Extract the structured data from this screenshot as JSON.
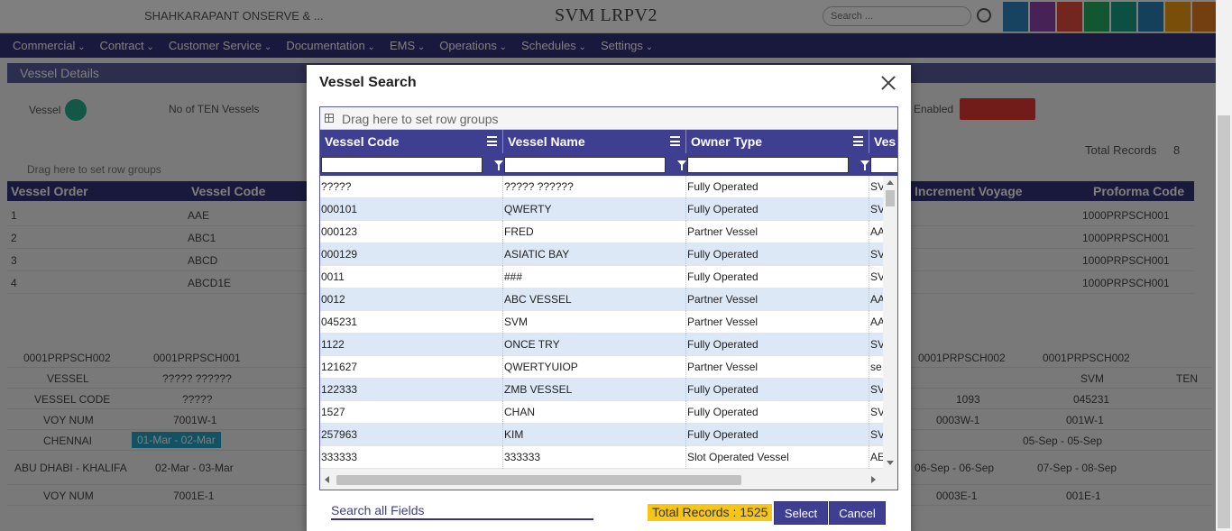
{
  "background": {
    "company": "SHAHKARAPANT ONSERVE & ...",
    "app_title": "SVM LRPV2",
    "search_placeholder": "Search ...",
    "nav": [
      "Commercial",
      "Contract",
      "Customer Service",
      "Documentation",
      "EMS",
      "Operations",
      "Schedules",
      "Settings"
    ],
    "section_title": "Vessel Details",
    "vessel_label": "Vessel",
    "ten_label": "No of TEN Vessels",
    "enabled_label": "Enabled",
    "total_records_label": "Total Records",
    "total_records_value": "8",
    "row_group_hint": "Drag here to set row groups",
    "grid_headers": [
      "Vessel Order",
      "Vessel Code",
      "Increment Voyage",
      "Proforma Code"
    ],
    "rows": [
      {
        "order": "1",
        "code": "AAE",
        "proforma": "1000PRPSCH001"
      },
      {
        "order": "2",
        "code": "ABC1",
        "proforma": "1000PRPSCH001"
      },
      {
        "order": "3",
        "code": "ABCD",
        "proforma": "1000PRPSCH001"
      },
      {
        "order": "4",
        "code": "ABCD1E",
        "proforma": "1000PRPSCH001"
      }
    ],
    "schedule": {
      "r1": [
        "0001PRPSCH002",
        "0001PRPSCH001",
        "0001PRPSCH002",
        "0001PRPSCH002"
      ],
      "r2": [
        "VESSEL",
        "????? ??????",
        "SVM",
        "TEN"
      ],
      "r3": [
        "VESSEL CODE",
        "?????",
        "1093",
        "045231"
      ],
      "r4": [
        "VOY NUM",
        "7001W-1",
        "0003W-1",
        "001W-1"
      ],
      "r5": [
        "CHENNAI",
        "01-Mar - 02-Mar",
        "05-Sep - 05-Sep"
      ],
      "r6": [
        "ABU DHABI - KHALIFA",
        "02-Mar - 03-Mar",
        "06-Sep - 06-Sep",
        "07-Sep - 08-Sep"
      ],
      "r7": [
        "VOY NUM",
        "7001E-1",
        "0003E-1",
        "001E-1"
      ]
    }
  },
  "modal": {
    "title": "Vessel Search",
    "group_hint": "Drag here to set row groups",
    "columns": [
      "Vessel Code",
      "Vessel Name",
      "Owner Type",
      "Ves"
    ],
    "rows": [
      [
        "?????",
        "????? ??????",
        "Fully Operated",
        "SV"
      ],
      [
        "000101",
        "QWERTY",
        "Fully Operated",
        "SV"
      ],
      [
        "000123",
        "FRED",
        "Partner Vessel",
        "AA"
      ],
      [
        "000129",
        "ASIATIC BAY",
        "Fully Operated",
        "SV"
      ],
      [
        "0011",
        "###",
        "Fully Operated",
        "SV"
      ],
      [
        "0012",
        "ABC VESSEL",
        "Partner Vessel",
        "AA"
      ],
      [
        "045231",
        "SVM",
        "Partner Vessel",
        "AA"
      ],
      [
        "1122",
        "ONCE TRY",
        "Fully Operated",
        "SV"
      ],
      [
        "121627",
        "QWERTYUIOP",
        "Partner Vessel",
        "se"
      ],
      [
        "122333",
        "ZMB VESSEL",
        "Fully Operated",
        "SV"
      ],
      [
        "1527",
        "CHAN",
        "Fully Operated",
        "SV"
      ],
      [
        "257963",
        "KIM",
        "Fully Operated",
        "SV"
      ],
      [
        "333333",
        "333333",
        "Slot Operated Vessel",
        "AE"
      ]
    ],
    "search_placeholder": "Search all Fields",
    "total_records": "Total Records : 1525",
    "select_label": "Select",
    "cancel_label": "Cancel"
  },
  "colors": {
    "header": "#3f3f91",
    "navbar": "#32327a",
    "alt_row": "#dde8f6",
    "total_badge": "#f5c518"
  }
}
